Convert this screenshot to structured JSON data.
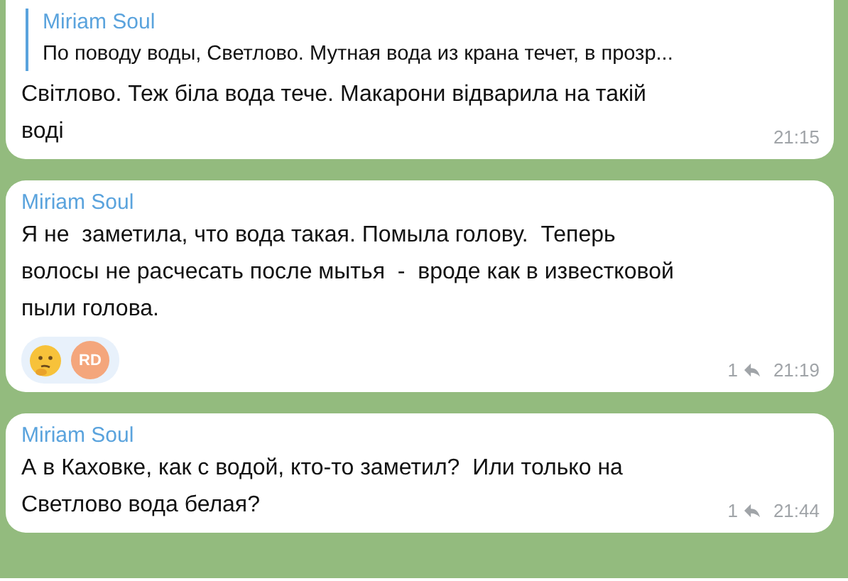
{
  "messages": [
    {
      "quote": {
        "sender": "Miriam Soul",
        "text": "По поводу воды, Светлово. Мутная вода из крана течет, в прозр..."
      },
      "text": "Світлово. Теж біла вода тече. Макарони відварила на такій воді",
      "time": "21:15"
    },
    {
      "sender": "Miriam Soul",
      "text": "Я не  заметила, что вода такая. Помыла голову.  Теперь волосы не расчесать после мытья  -  вроде как в известковой пыли голова.",
      "reactions": [
        {
          "kind": "emoji"
        },
        {
          "kind": "avatar",
          "initials": "RD",
          "color": "#f4a67c"
        }
      ],
      "replies": "1",
      "time": "21:19"
    },
    {
      "sender": "Miriam Soul",
      "text": "А в Каховке, как с водой, кто-то заметил?  Или только на Светлово вода белая?",
      "replies": "1",
      "time": "21:44"
    }
  ]
}
